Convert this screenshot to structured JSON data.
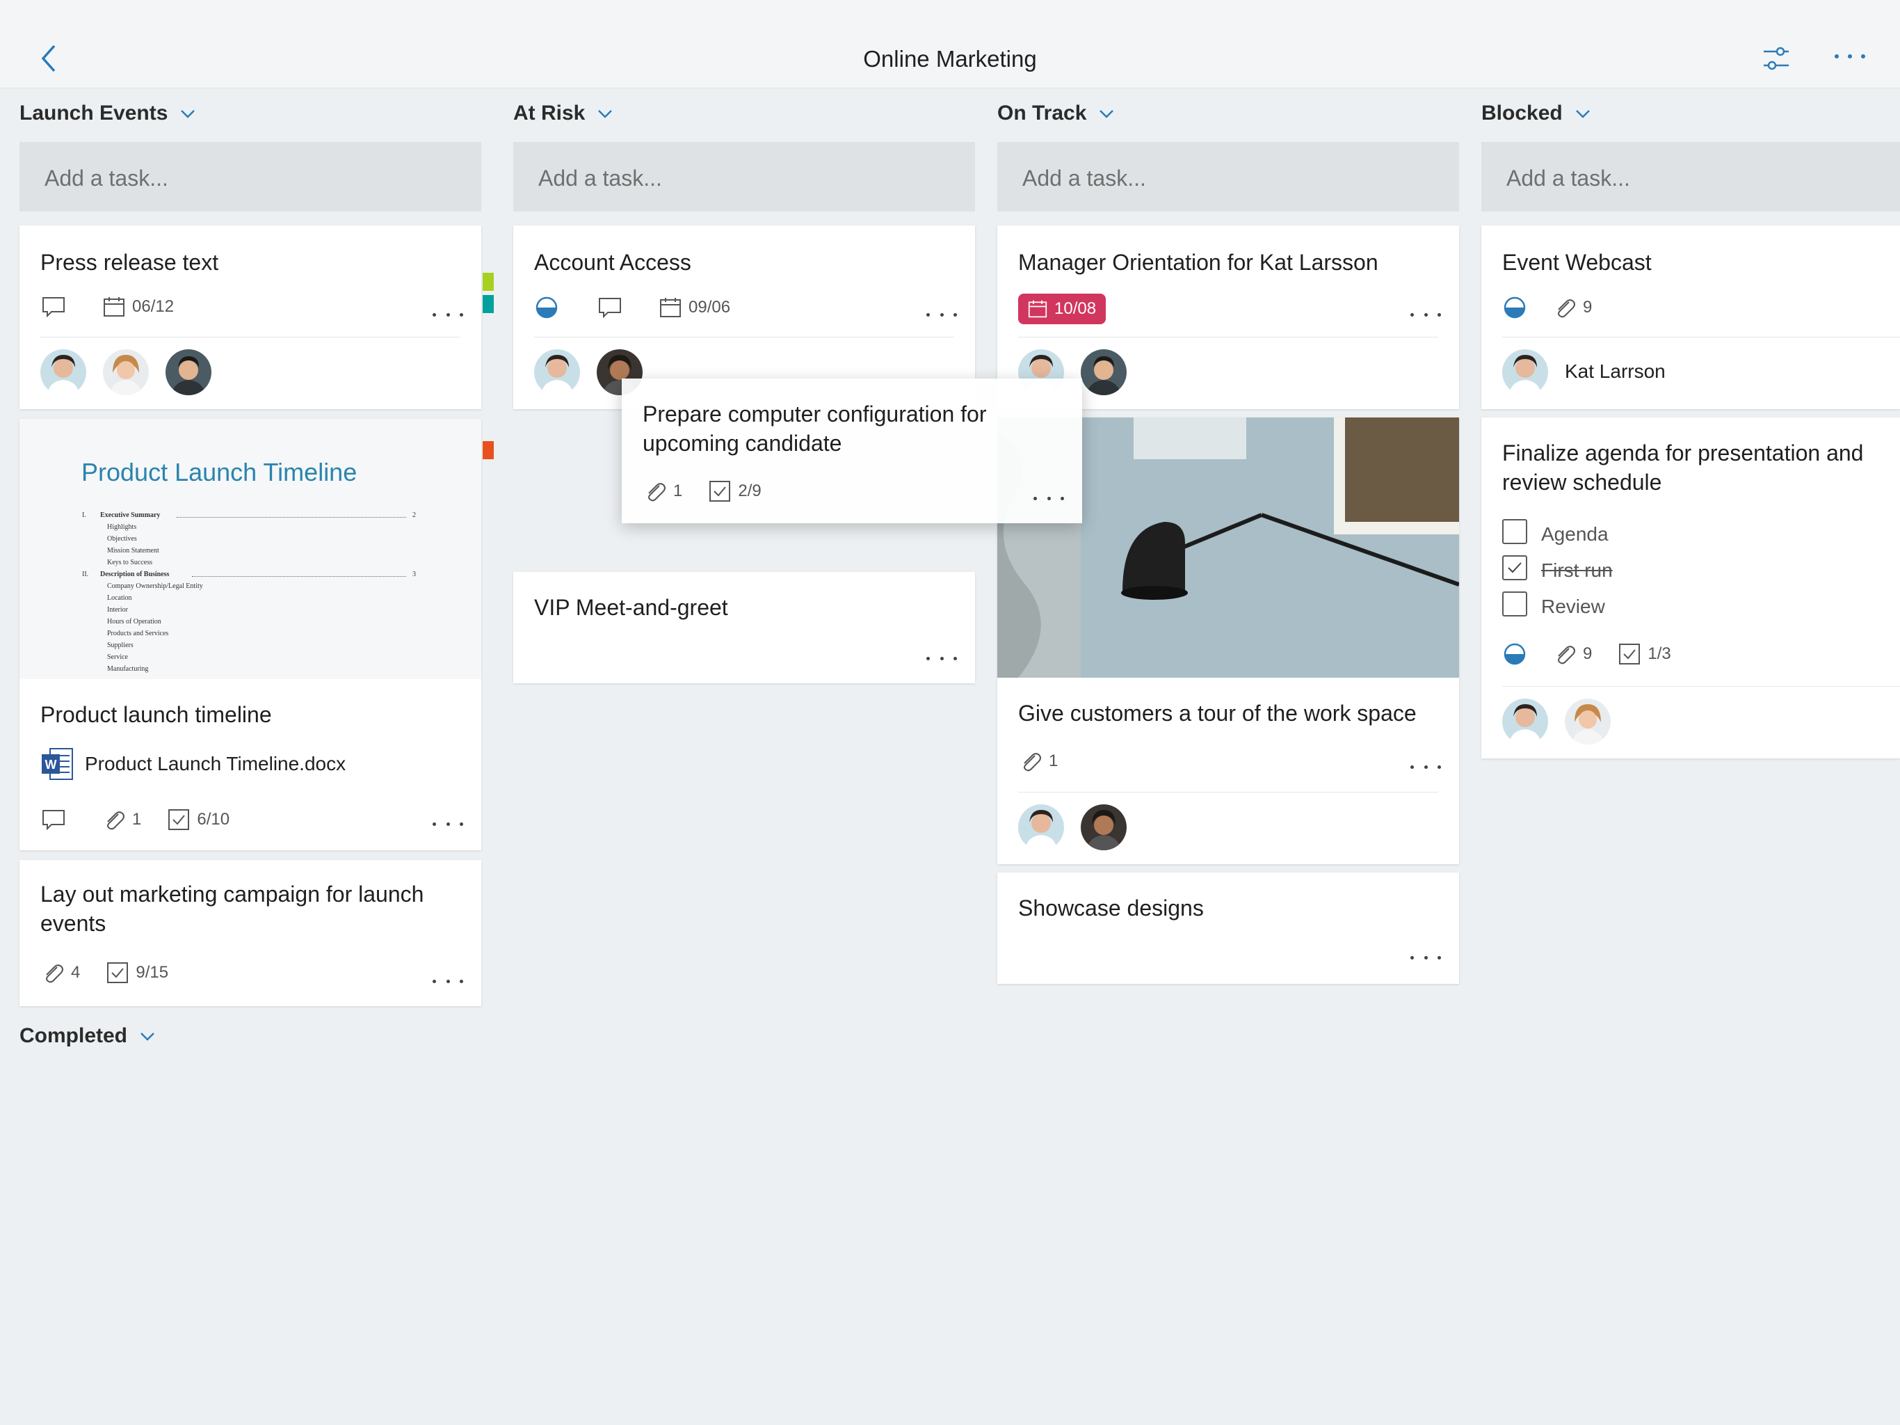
{
  "header": {
    "title": "Online Marketing"
  },
  "add_task_placeholder": "Add a task...",
  "columns": [
    {
      "name": "Launch Events"
    },
    {
      "name": "At Risk"
    },
    {
      "name": "On Track"
    },
    {
      "name": "Blocked"
    }
  ],
  "completed_label": "Completed",
  "cards": {
    "press_release": {
      "title": "Press release text",
      "due": "06/12"
    },
    "product_timeline": {
      "preview_title": "Product Launch Timeline",
      "preview_toc": [
        "I.",
        "Executive Summary",
        "2",
        "Highlights",
        "Objectives",
        "Mission Statement",
        "Keys to Success",
        "II.",
        "Description of Business",
        "3",
        "Company Ownership/Legal Entity",
        "Location",
        "Interior",
        "Hours of Operation",
        "Products and Services",
        "Suppliers",
        "Service",
        "Manufacturing"
      ],
      "title": "Product launch timeline",
      "attachment": "Product Launch Timeline.docx",
      "attachments": "1",
      "checklist": "6/10"
    },
    "marketing_campaign": {
      "title_line1": "Lay out marketing campaign for launch",
      "title_line2": "events",
      "attachments": "4",
      "checklist": "9/15"
    },
    "account_access": {
      "title": "Account Access",
      "due": "09/06"
    },
    "drag_card": {
      "title_line1": "Prepare computer configuration for",
      "title_line2": "upcoming candidate",
      "attachments": "1",
      "checklist": "2/9"
    },
    "vip": {
      "title": "VIP Meet-and-greet"
    },
    "manager_orientation": {
      "title": "Manager Orientation for Kat Larsson",
      "due": "10/08"
    },
    "tour": {
      "title": "Give customers a tour of the work space",
      "attachments": "1"
    },
    "showcase": {
      "title": "Showcase designs"
    },
    "event_webcast": {
      "title": "Event Webcast",
      "attachments": "9",
      "assignee": "Kat Larrson"
    },
    "finalize_agenda": {
      "title_line1": "Finalize agenda for presentation and",
      "title_line2": "review schedule",
      "checklist_items": [
        {
          "label": "Agenda",
          "checked": false
        },
        {
          "label": "First run",
          "checked": true
        },
        {
          "label": "Review",
          "checked": false
        }
      ],
      "attachments": "9",
      "checklist": "1/3"
    }
  },
  "colors": {
    "accent": "#2b7bb9",
    "due_badge": "#d1365f",
    "label_green": "#a7d020",
    "label_teal": "#00a19c",
    "label_orange": "#e8501f"
  }
}
